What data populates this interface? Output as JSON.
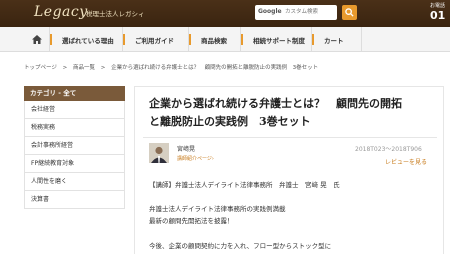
{
  "header": {
    "logo": "Legacy",
    "logo_sub": "税理士法人レガシィ",
    "search": {
      "brand": "Google",
      "placeholder": "カスタム検索"
    },
    "phone": {
      "label": "お電話",
      "number": "01"
    }
  },
  "nav": {
    "items": [
      {
        "label": "選ばれている理由"
      },
      {
        "label": "ご利用ガイド"
      },
      {
        "label": "商品検索"
      },
      {
        "label": "相続サポート制度"
      },
      {
        "label": "カート"
      }
    ]
  },
  "breadcrumb": {
    "items": [
      "トップページ",
      ">",
      "商品一覧",
      ">",
      "企業から選ばれ続ける弁護士とは？　顧問先の開拓と離脱防止の実践例　3巻セット"
    ]
  },
  "sidebar": {
    "heading": "カテゴリ - 全て",
    "items": [
      {
        "label": "会社経営"
      },
      {
        "label": "税務実務"
      },
      {
        "label": "会計事務所経営"
      },
      {
        "label": "FP継続教育対象"
      },
      {
        "label": "人間性を磨く"
      },
      {
        "label": "決算書"
      }
    ]
  },
  "product": {
    "title_line1": "企業から選ばれ続ける弁護士とは？　顧問先の開拓",
    "title_line2": "と離脱防止の実践例　3巻セット",
    "author_name": "宮﨑晃",
    "author_link": "講師紹介ページ›",
    "date": "2018T023～2018T906",
    "review_link": "レビューを見る",
    "lecturer": "【講師】弁護士法人デイライト法律事務所　弁護士　宮﨑 晃　氏",
    "desc1": "弁護士法人デイライト法律事務所の実践例満載",
    "desc2": "最新の顧問先開拓法を披露！",
    "desc3": "今後、企業の顧問契約に力を入れ、フロー型からストック型に"
  },
  "colors": {
    "header_bg": "#3a2410",
    "accent": "#e89a2d",
    "sidebar_head": "#7a5a3a",
    "link": "#c77a1a"
  }
}
